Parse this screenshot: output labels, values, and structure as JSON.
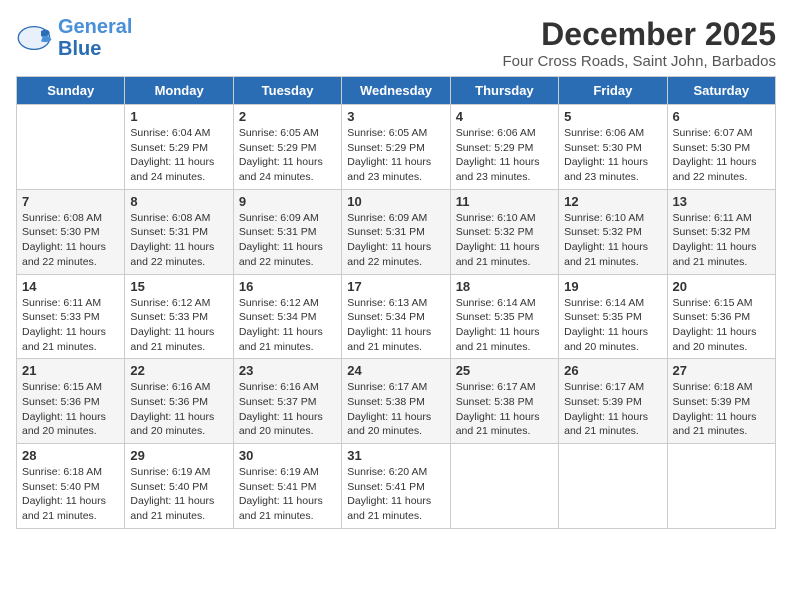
{
  "logo": {
    "line1": "General",
    "line2": "Blue"
  },
  "title": "December 2025",
  "subtitle": "Four Cross Roads, Saint John, Barbados",
  "days_of_week": [
    "Sunday",
    "Monday",
    "Tuesday",
    "Wednesday",
    "Thursday",
    "Friday",
    "Saturday"
  ],
  "weeks": [
    [
      {
        "day": "",
        "sunrise": "",
        "sunset": "",
        "daylight": ""
      },
      {
        "day": "1",
        "sunrise": "Sunrise: 6:04 AM",
        "sunset": "Sunset: 5:29 PM",
        "daylight": "Daylight: 11 hours and 24 minutes."
      },
      {
        "day": "2",
        "sunrise": "Sunrise: 6:05 AM",
        "sunset": "Sunset: 5:29 PM",
        "daylight": "Daylight: 11 hours and 24 minutes."
      },
      {
        "day": "3",
        "sunrise": "Sunrise: 6:05 AM",
        "sunset": "Sunset: 5:29 PM",
        "daylight": "Daylight: 11 hours and 23 minutes."
      },
      {
        "day": "4",
        "sunrise": "Sunrise: 6:06 AM",
        "sunset": "Sunset: 5:29 PM",
        "daylight": "Daylight: 11 hours and 23 minutes."
      },
      {
        "day": "5",
        "sunrise": "Sunrise: 6:06 AM",
        "sunset": "Sunset: 5:30 PM",
        "daylight": "Daylight: 11 hours and 23 minutes."
      },
      {
        "day": "6",
        "sunrise": "Sunrise: 6:07 AM",
        "sunset": "Sunset: 5:30 PM",
        "daylight": "Daylight: 11 hours and 22 minutes."
      }
    ],
    [
      {
        "day": "7",
        "sunrise": "Sunrise: 6:08 AM",
        "sunset": "Sunset: 5:30 PM",
        "daylight": "Daylight: 11 hours and 22 minutes."
      },
      {
        "day": "8",
        "sunrise": "Sunrise: 6:08 AM",
        "sunset": "Sunset: 5:31 PM",
        "daylight": "Daylight: 11 hours and 22 minutes."
      },
      {
        "day": "9",
        "sunrise": "Sunrise: 6:09 AM",
        "sunset": "Sunset: 5:31 PM",
        "daylight": "Daylight: 11 hours and 22 minutes."
      },
      {
        "day": "10",
        "sunrise": "Sunrise: 6:09 AM",
        "sunset": "Sunset: 5:31 PM",
        "daylight": "Daylight: 11 hours and 22 minutes."
      },
      {
        "day": "11",
        "sunrise": "Sunrise: 6:10 AM",
        "sunset": "Sunset: 5:32 PM",
        "daylight": "Daylight: 11 hours and 21 minutes."
      },
      {
        "day": "12",
        "sunrise": "Sunrise: 6:10 AM",
        "sunset": "Sunset: 5:32 PM",
        "daylight": "Daylight: 11 hours and 21 minutes."
      },
      {
        "day": "13",
        "sunrise": "Sunrise: 6:11 AM",
        "sunset": "Sunset: 5:32 PM",
        "daylight": "Daylight: 11 hours and 21 minutes."
      }
    ],
    [
      {
        "day": "14",
        "sunrise": "Sunrise: 6:11 AM",
        "sunset": "Sunset: 5:33 PM",
        "daylight": "Daylight: 11 hours and 21 minutes."
      },
      {
        "day": "15",
        "sunrise": "Sunrise: 6:12 AM",
        "sunset": "Sunset: 5:33 PM",
        "daylight": "Daylight: 11 hours and 21 minutes."
      },
      {
        "day": "16",
        "sunrise": "Sunrise: 6:12 AM",
        "sunset": "Sunset: 5:34 PM",
        "daylight": "Daylight: 11 hours and 21 minutes."
      },
      {
        "day": "17",
        "sunrise": "Sunrise: 6:13 AM",
        "sunset": "Sunset: 5:34 PM",
        "daylight": "Daylight: 11 hours and 21 minutes."
      },
      {
        "day": "18",
        "sunrise": "Sunrise: 6:14 AM",
        "sunset": "Sunset: 5:35 PM",
        "daylight": "Daylight: 11 hours and 21 minutes."
      },
      {
        "day": "19",
        "sunrise": "Sunrise: 6:14 AM",
        "sunset": "Sunset: 5:35 PM",
        "daylight": "Daylight: 11 hours and 20 minutes."
      },
      {
        "day": "20",
        "sunrise": "Sunrise: 6:15 AM",
        "sunset": "Sunset: 5:36 PM",
        "daylight": "Daylight: 11 hours and 20 minutes."
      }
    ],
    [
      {
        "day": "21",
        "sunrise": "Sunrise: 6:15 AM",
        "sunset": "Sunset: 5:36 PM",
        "daylight": "Daylight: 11 hours and 20 minutes."
      },
      {
        "day": "22",
        "sunrise": "Sunrise: 6:16 AM",
        "sunset": "Sunset: 5:36 PM",
        "daylight": "Daylight: 11 hours and 20 minutes."
      },
      {
        "day": "23",
        "sunrise": "Sunrise: 6:16 AM",
        "sunset": "Sunset: 5:37 PM",
        "daylight": "Daylight: 11 hours and 20 minutes."
      },
      {
        "day": "24",
        "sunrise": "Sunrise: 6:17 AM",
        "sunset": "Sunset: 5:38 PM",
        "daylight": "Daylight: 11 hours and 20 minutes."
      },
      {
        "day": "25",
        "sunrise": "Sunrise: 6:17 AM",
        "sunset": "Sunset: 5:38 PM",
        "daylight": "Daylight: 11 hours and 21 minutes."
      },
      {
        "day": "26",
        "sunrise": "Sunrise: 6:17 AM",
        "sunset": "Sunset: 5:39 PM",
        "daylight": "Daylight: 11 hours and 21 minutes."
      },
      {
        "day": "27",
        "sunrise": "Sunrise: 6:18 AM",
        "sunset": "Sunset: 5:39 PM",
        "daylight": "Daylight: 11 hours and 21 minutes."
      }
    ],
    [
      {
        "day": "28",
        "sunrise": "Sunrise: 6:18 AM",
        "sunset": "Sunset: 5:40 PM",
        "daylight": "Daylight: 11 hours and 21 minutes."
      },
      {
        "day": "29",
        "sunrise": "Sunrise: 6:19 AM",
        "sunset": "Sunset: 5:40 PM",
        "daylight": "Daylight: 11 hours and 21 minutes."
      },
      {
        "day": "30",
        "sunrise": "Sunrise: 6:19 AM",
        "sunset": "Sunset: 5:41 PM",
        "daylight": "Daylight: 11 hours and 21 minutes."
      },
      {
        "day": "31",
        "sunrise": "Sunrise: 6:20 AM",
        "sunset": "Sunset: 5:41 PM",
        "daylight": "Daylight: 11 hours and 21 minutes."
      },
      {
        "day": "",
        "sunrise": "",
        "sunset": "",
        "daylight": ""
      },
      {
        "day": "",
        "sunrise": "",
        "sunset": "",
        "daylight": ""
      },
      {
        "day": "",
        "sunrise": "",
        "sunset": "",
        "daylight": ""
      }
    ]
  ]
}
